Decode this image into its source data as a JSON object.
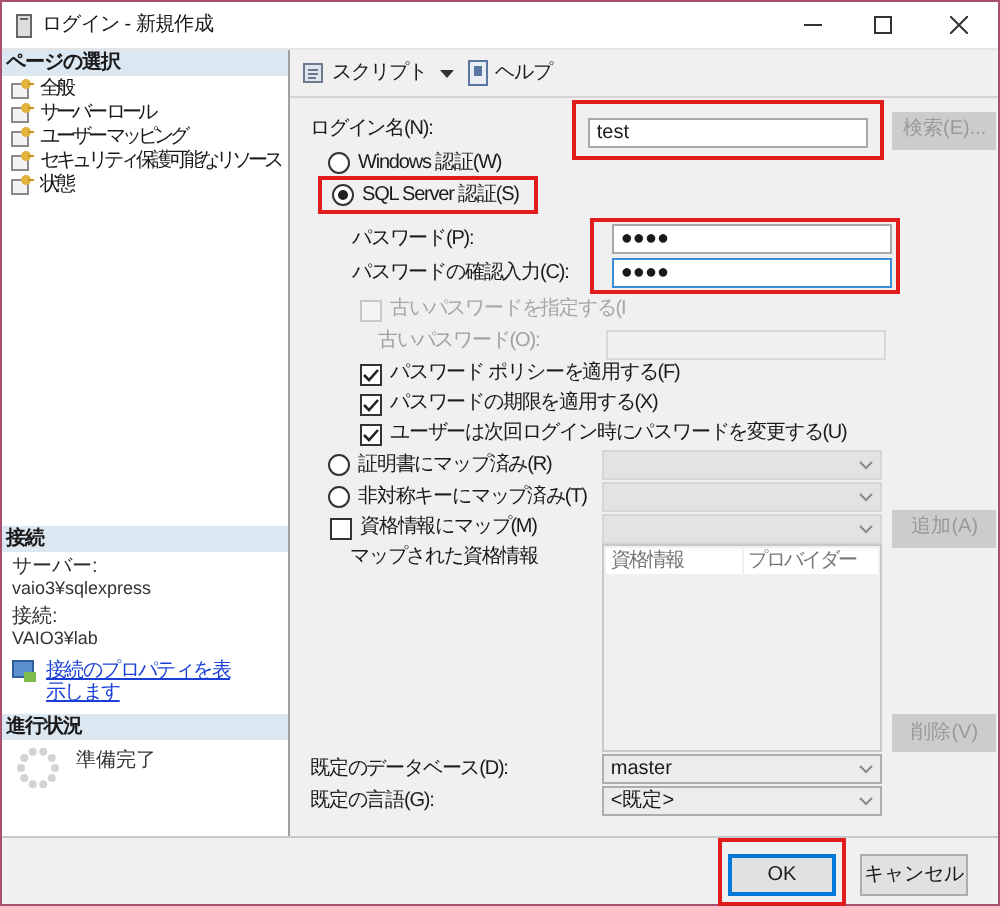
{
  "window": {
    "title": "ログイン - 新規作成"
  },
  "sidebar": {
    "pages_header": "ページの選択",
    "pages": [
      {
        "label": "全般",
        "selected": false
      },
      {
        "label": "サーバー ロール",
        "selected": false
      },
      {
        "label": "ユーザー マッピング",
        "selected": false
      },
      {
        "label": "セキュリティ保護可能なリソース",
        "selected": false
      },
      {
        "label": "状態",
        "selected": false
      }
    ],
    "connection": {
      "header": "接続",
      "server_label": "サーバー:",
      "server": "vaio3¥sqlexpress",
      "connection_label": "接続:",
      "connection": "VAIO3¥lab",
      "link": "接続のプロパティを表示します"
    },
    "progress": {
      "header": "進行状況",
      "status": "準備完了"
    }
  },
  "toolbar": [
    {
      "kind": "dropdown",
      "label": "スクリプト"
    },
    {
      "kind": "help",
      "label": "ヘルプ"
    }
  ],
  "form": {
    "rows": [
      {
        "kind": "text_field",
        "label": "ログイン名(N):",
        "value": "test",
        "highlighted": true,
        "side_button": {
          "label": "検索(E)...",
          "disabled": true
        }
      },
      {
        "kind": "radio",
        "label": "Windows 認証(W)",
        "selected": false
      },
      {
        "kind": "radio",
        "label": "SQL Server 認証(S)",
        "selected": true,
        "highlighted": true,
        "children": [
          {
            "kind": "field_group",
            "highlighted": true,
            "fields": [
              {
                "label": "パスワード(P):",
                "value": "●●●●",
                "focused": false
              },
              {
                "label": "パスワードの確認入力(C):",
                "value": "●●●●",
                "focused": true
              }
            ]
          },
          {
            "kind": "checkbox",
            "label": "古いパスワードを指定する(I",
            "checked": false,
            "disabled": true
          },
          {
            "kind": "text_field",
            "label": "古いパスワード(O):",
            "disabled": true
          },
          {
            "kind": "checkbox",
            "label": "パスワード ポリシーを適用する(F)",
            "checked": true,
            "disabled": false
          },
          {
            "kind": "checkbox",
            "label": "パスワードの期限を適用する(X)",
            "checked": true,
            "disabled": false
          },
          {
            "kind": "checkbox",
            "label": "ユーザーは次回ログイン時にパスワードを変更する(U)",
            "checked": true,
            "disabled": false
          }
        ]
      },
      {
        "kind": "radio",
        "label": "証明書にマップ済み(R)",
        "selected": false,
        "combo": {
          "disabled": true
        }
      },
      {
        "kind": "radio",
        "label": "非対称キーにマップ済み(T)",
        "selected": false,
        "combo": {
          "disabled": true
        }
      },
      {
        "kind": "checkbox",
        "label": "資格情報にマップ(M)",
        "checked": false,
        "disabled": false,
        "combo": {
          "disabled": true
        },
        "side_button": {
          "label": "追加(A)",
          "disabled": true
        }
      },
      {
        "kind": "list",
        "label": "マップされた資格情報",
        "columns": [
          "資格情報",
          "プロバイダー"
        ],
        "side_button": {
          "label": "削除(V)",
          "disabled": true
        }
      },
      {
        "kind": "combo",
        "label": "既定のデータベース(D):",
        "value": "master"
      },
      {
        "kind": "combo",
        "label": "既定の言語(G):",
        "value": "<既定>"
      }
    ]
  },
  "buttons": [
    {
      "label": "OK",
      "default": true,
      "highlighted": true
    },
    {
      "label": "キャンセル",
      "default": false
    }
  ]
}
